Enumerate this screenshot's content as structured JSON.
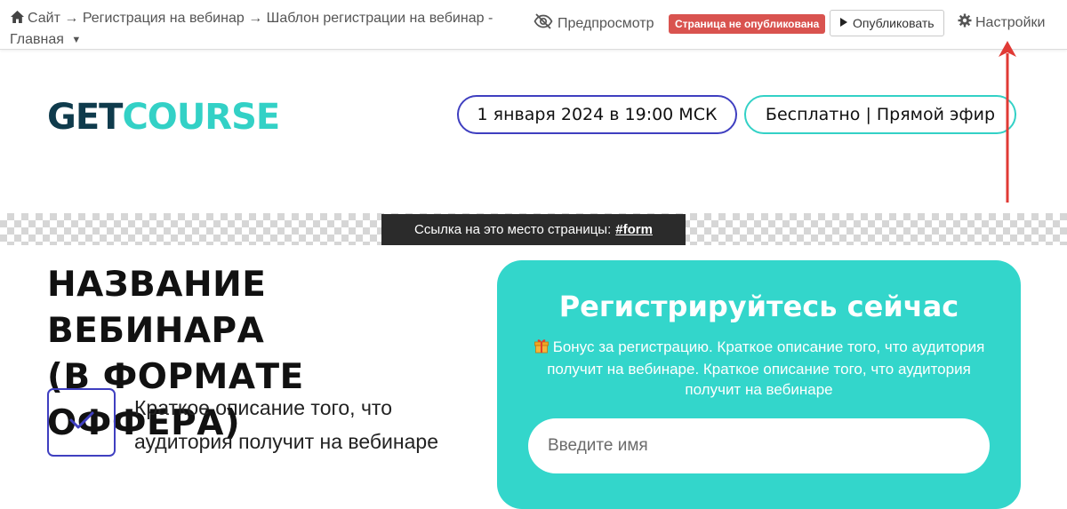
{
  "toolbar": {
    "breadcrumb": {
      "site": "Сайт",
      "separator": "→",
      "section": "Регистрация на вебинар",
      "page": "Шаблон регистрации на вебинар - Главная"
    },
    "preview_label": "Предпросмотр",
    "status_badge": "Страница не опубликована",
    "publish_label": "Опубликовать",
    "settings_label": "Настройки"
  },
  "header": {
    "logo_part1": "GET",
    "logo_part2": "COURSE",
    "date_pill": "1 января 2024 в 19:00 МСК",
    "format_pill": "Бесплатно | Прямой эфир"
  },
  "anchor": {
    "label": "Ссылка на это место страницы:",
    "hash": "#form"
  },
  "content": {
    "title_line1": "НАЗВАНИЕ ВЕБИНАРА",
    "title_line2": "(В ФОРМАТЕ ОФФЕРА)",
    "benefit_line1": "Краткое описание того, что",
    "benefit_line2": "аудитория получит на вебинаре"
  },
  "form": {
    "title": "Регистрируйтесь сейчас",
    "bonus_text": "Бонус за регистрацию. Краткое описание того, что аудитория получит на вебинаре. Краткое описание того, что аудитория получит на вебинаре",
    "name_placeholder": "Введите имя"
  },
  "colors": {
    "accent_teal": "#33d6cb",
    "accent_blue": "#3f3fc0",
    "logo_dark": "#0f3b4c",
    "badge_red": "#d9534f",
    "annotation_red": "#e03a35"
  },
  "icons": [
    "home-icon",
    "chevron-down-icon",
    "eye-slash-icon",
    "play-icon",
    "gear-icon",
    "check-icon",
    "gift-icon",
    "arrow-up-icon"
  ]
}
